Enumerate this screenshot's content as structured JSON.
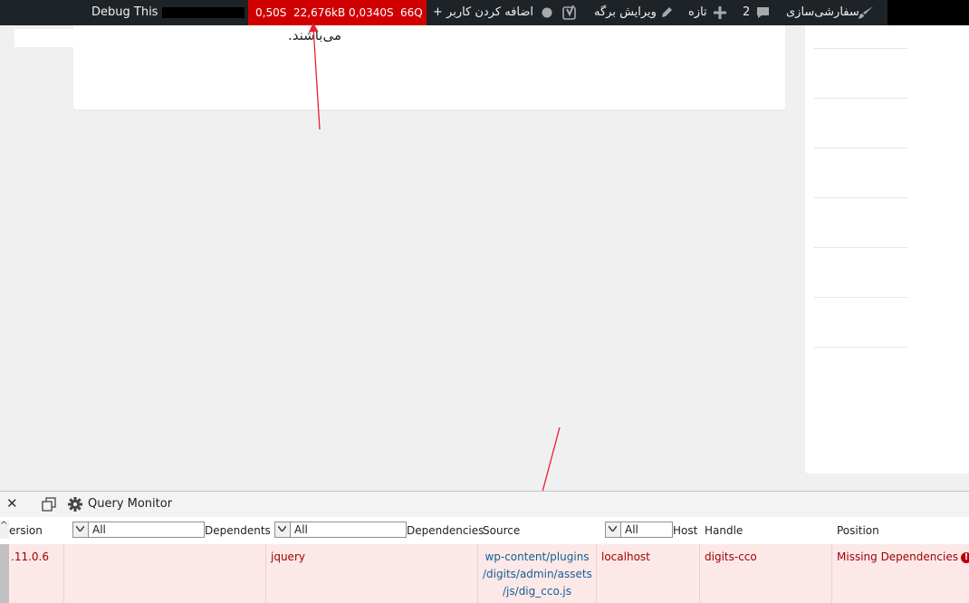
{
  "adminbar": {
    "debug_label": "Debug This",
    "qm": {
      "time": "0,50S",
      "memory": "22,676kB",
      "db_time": "0,0340S",
      "queries": "66Q"
    },
    "add_user": "+ اضافه کردن کاربر",
    "edit_page": "ویرایش برگه",
    "new": "تازه",
    "comments_count": "2",
    "customize": "سفارشی‌سازی"
  },
  "content": {
    "rtl_text": "می‌باشند."
  },
  "query_monitor": {
    "title": "Query Monitor",
    "columns": {
      "version": "ersion",
      "dependents": "Dependents",
      "dependencies": "Dependencies",
      "source": "Source",
      "host": "Host",
      "handle": "Handle",
      "position": "Position"
    },
    "filters": {
      "dependents": "All",
      "dependencies": "All",
      "host": "All"
    },
    "row": {
      "version": ".11.0.6",
      "dependents": "",
      "dependencies": "jquery",
      "source_line1": "wp-content/plugins",
      "source_line2": "/digits/admin/assets",
      "source_line3": "/js/dig_cco.js",
      "host": "localhost",
      "handle": "digits-cco",
      "position": "Missing Dependencies"
    }
  },
  "colors": {
    "adminbar_bg": "#1d2327",
    "qm_alert_bg": "#d00000",
    "row_error_bg": "#fde8e8",
    "link": "#135e96",
    "error_text": "#9d0000"
  }
}
